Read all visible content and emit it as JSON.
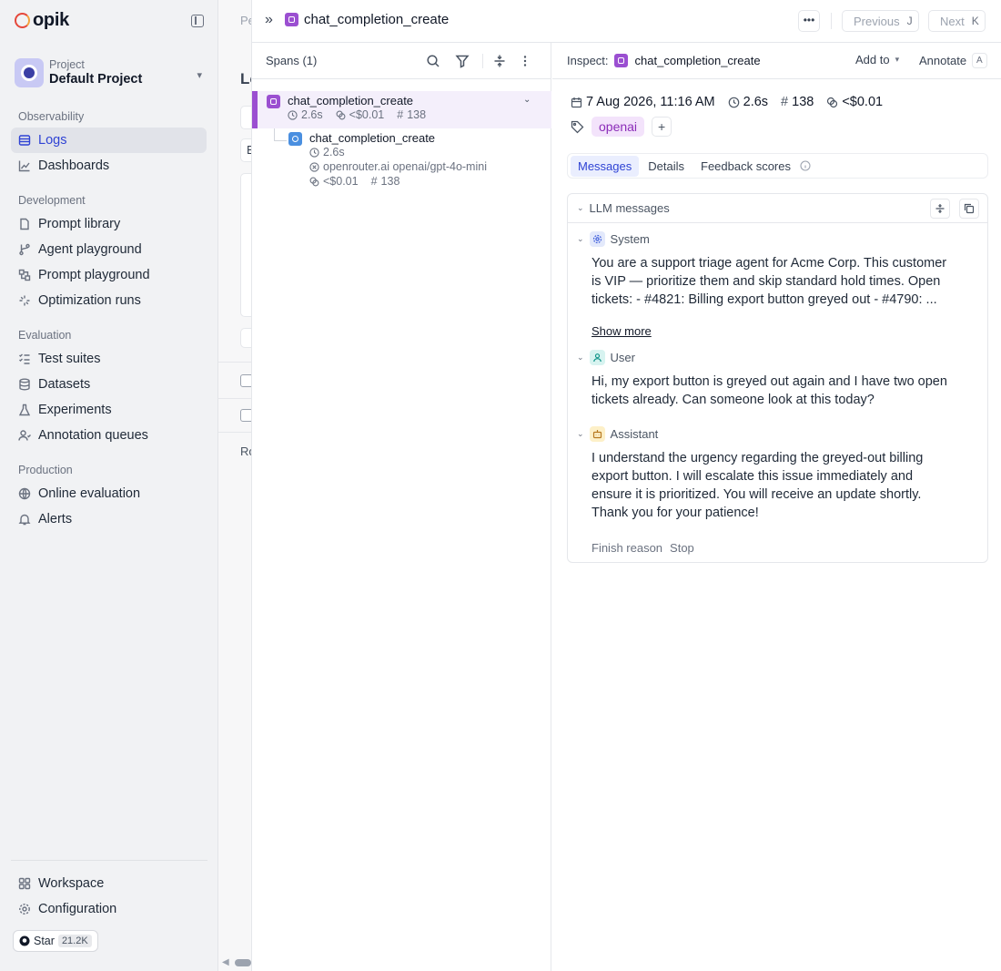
{
  "app": {
    "name": "opik"
  },
  "project": {
    "label": "Project",
    "name": "Default Project"
  },
  "nav": {
    "sections": [
      {
        "title": "Observability",
        "items": [
          {
            "label": "Logs",
            "icon": "logs-icon",
            "active": true
          },
          {
            "label": "Dashboards",
            "icon": "chart-icon"
          }
        ]
      },
      {
        "title": "Development",
        "items": [
          {
            "label": "Prompt library",
            "icon": "file-icon"
          },
          {
            "label": "Agent playground",
            "icon": "branch-icon"
          },
          {
            "label": "Prompt playground",
            "icon": "blocks-icon"
          },
          {
            "label": "Optimization runs",
            "icon": "sparkle-icon"
          }
        ]
      },
      {
        "title": "Evaluation",
        "items": [
          {
            "label": "Test suites",
            "icon": "checklist-icon"
          },
          {
            "label": "Datasets",
            "icon": "database-icon"
          },
          {
            "label": "Experiments",
            "icon": "flask-icon"
          },
          {
            "label": "Annotation queues",
            "icon": "user-queue-icon"
          }
        ]
      },
      {
        "title": "Production",
        "items": [
          {
            "label": "Online evaluation",
            "icon": "globe-icon"
          },
          {
            "label": "Alerts",
            "icon": "bell-icon"
          }
        ]
      }
    ],
    "footer": [
      {
        "label": "Workspace",
        "icon": "grid-icon"
      },
      {
        "label": "Configuration",
        "icon": "settings-icon"
      }
    ],
    "star": {
      "label": "Star",
      "count": "21.2K"
    }
  },
  "peek": {
    "breadcrumb": "Pe",
    "heading": "Lo",
    "b": "B",
    "ro": "Ro"
  },
  "drawer": {
    "title": "chat_completion_create",
    "previous": {
      "label": "Previous",
      "key": "J"
    },
    "next": {
      "label": "Next",
      "key": "K"
    }
  },
  "spans": {
    "title": "Spans (1)",
    "tree": [
      {
        "name": "chat_completion_create",
        "duration": "2.6s",
        "cost": "<$0.01",
        "tokens": "138"
      },
      {
        "name": "chat_completion_create",
        "duration": "2.6s",
        "model": "openrouter.ai openai/gpt-4o-mini",
        "cost": "<$0.01",
        "tokens": "138"
      }
    ]
  },
  "inspect": {
    "label": "Inspect:",
    "name": "chat_completion_create",
    "add_to": "Add to",
    "annotate": {
      "label": "Annotate",
      "key": "A"
    },
    "meta": {
      "date": "7 Aug 2026, 11:16 AM",
      "duration": "2.6s",
      "tokens": "138",
      "cost": "<$0.01"
    },
    "tag": "openai",
    "tabs": [
      "Messages",
      "Details",
      "Feedback scores"
    ],
    "llm": {
      "title": "LLM messages",
      "messages": [
        {
          "role": "System",
          "lines": [
            "You are a support triage agent for Acme Corp. This customer",
            "is VIP — prioritize them and skip standard hold times. Open",
            "tickets: - #4821: Billing export button greyed out - #4790: ..."
          ]
        },
        {
          "role": "User",
          "lines": [
            "Hi, my export button is greyed out again and I have two open",
            "tickets already. Can someone look at this today?"
          ]
        },
        {
          "role": "Assistant",
          "lines": [
            "I understand the urgency regarding the greyed-out billing",
            "export button. I will escalate this issue immediately and",
            "ensure it is prioritized. You will receive an update shortly.",
            "Thank you for your patience!"
          ]
        }
      ],
      "show_more": "Show more",
      "finish": {
        "label": "Finish reason",
        "value": "Stop"
      }
    }
  },
  "colors": {
    "accent": "#2f43d4",
    "span_purple": "#9b4fd1",
    "span_blue": "#4a8fe0",
    "tag_bg": "#f3e3fb"
  }
}
